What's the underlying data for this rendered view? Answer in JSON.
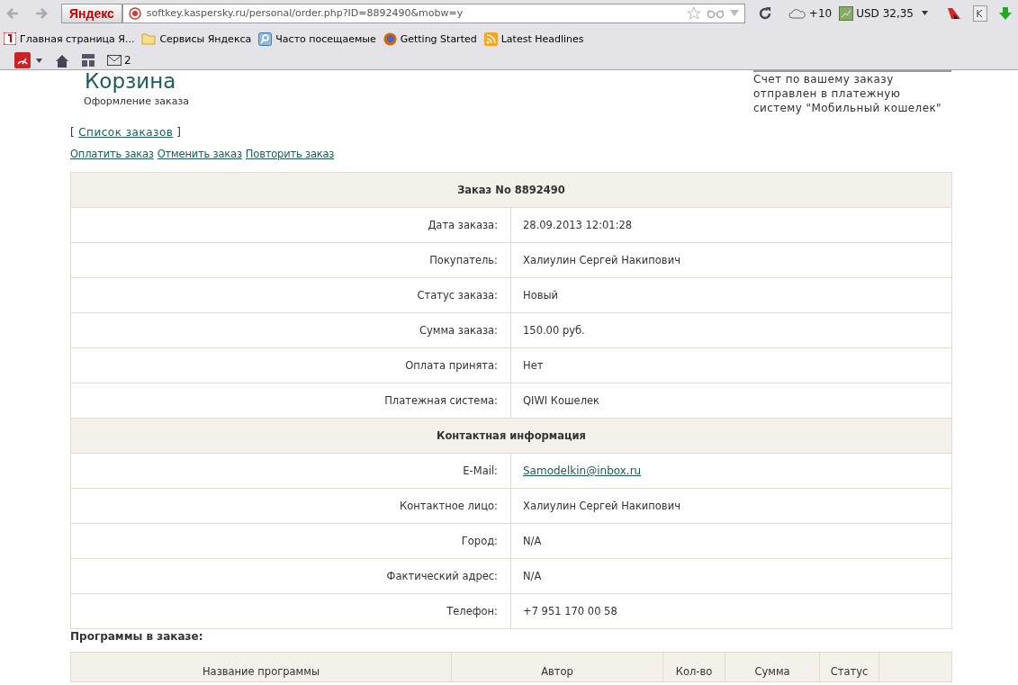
{
  "browser": {
    "search_button": "Яндекс",
    "address": "softkey.kaspersky.ru/personal/order.php?ID=8892490&mobw=y",
    "weather": "+10",
    "currency": "USD 32,35",
    "bookmarks": [
      {
        "label": "Главная страница Я...",
        "kind": "yandex"
      },
      {
        "label": "Сервисы Яндекса",
        "kind": "folder"
      },
      {
        "label": "Часто посещаемые",
        "kind": "search"
      },
      {
        "label": "Getting Started",
        "kind": "firefox"
      },
      {
        "label": "Latest Headlines",
        "kind": "rss"
      }
    ],
    "mail_count": "2"
  },
  "page": {
    "title": "Корзина",
    "subtitle": "Оформление заказа",
    "notice": "Счет по вашему заказу отправлен в платежную систему \"Мобильный кошелек\"",
    "orders_link": {
      "open": "[",
      "label": "Список заказов",
      "close": "]"
    },
    "actions": [
      "Оплатить заказ",
      "Отменить заказ",
      "Повторить заказ"
    ],
    "sections": [
      {
        "heading": "Заказ No 8892490",
        "rows": [
          {
            "label": "Дата заказа:",
            "value": "28.09.2013 12:01:28",
            "kind": "text"
          },
          {
            "label": "Покупатель:",
            "value": "Халиулин Сергей Накипович",
            "kind": "text"
          },
          {
            "label": "Статус заказа:",
            "value": "Новый",
            "kind": "text"
          },
          {
            "label": "Сумма заказа:",
            "value": "150.00 руб.",
            "kind": "text"
          },
          {
            "label": "Оплата принята:",
            "value": "Нет",
            "kind": "text"
          },
          {
            "label": "Платежная система:",
            "value": "QIWI Кошелек",
            "kind": "text"
          }
        ]
      },
      {
        "heading": "Контактная информация",
        "rows": [
          {
            "label": "E-Mail:",
            "value": "Samodelkin@inbox.ru",
            "kind": "link"
          },
          {
            "label": "Контактное лицо:",
            "value": "Халиулин Сергей Накипович",
            "kind": "text"
          },
          {
            "label": "Город:",
            "value": "N/A",
            "kind": "text"
          },
          {
            "label": "Фактический адрес:",
            "value": "N/A",
            "kind": "text"
          },
          {
            "label": "Телефон:",
            "value": "+7 951 170 00 58",
            "kind": "text"
          }
        ]
      }
    ],
    "programs": {
      "heading": "Программы в заказе:",
      "columns": [
        "Название программы",
        "Автор",
        "Кол-во",
        "Сумма",
        "Статус"
      ]
    }
  }
}
